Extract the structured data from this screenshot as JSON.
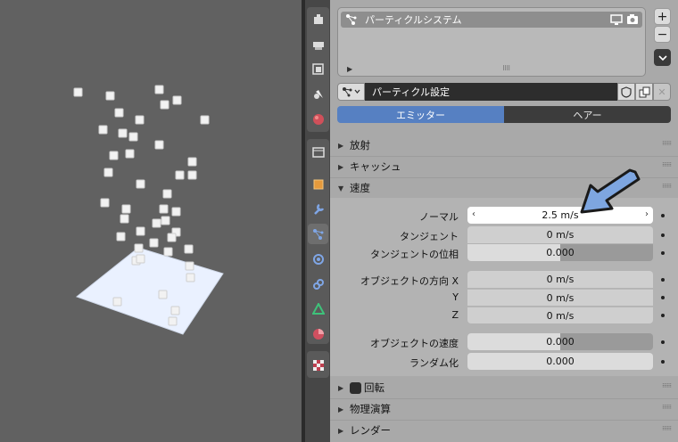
{
  "particle_system": {
    "list_item": "パーティクルシステム",
    "add_button": "+",
    "remove_button": "−"
  },
  "settings": {
    "name": "パーティクル設定"
  },
  "type_tabs": [
    {
      "label": "エミッター",
      "active": true
    },
    {
      "label": "ヘアー",
      "active": false
    }
  ],
  "panels": {
    "emission": "放射",
    "cache": "キャッシュ",
    "velocity": "速度",
    "rotation": "回転",
    "physics": "物理演算",
    "render": "レンダー"
  },
  "velocity": {
    "normal_label": "ノーマル",
    "normal_value": "2.5 m/s",
    "tangent_label": "タンジェント",
    "tangent_value": "0 m/s",
    "tangent_phase_label": "タンジェントの位相",
    "tangent_phase_value": "0.000",
    "tangent_phase_fraction": 0.5,
    "object_align_x_label": "オブジェクトの方向 X",
    "object_align_x_value": "0 m/s",
    "object_align_y_label": "Y",
    "object_align_y_value": "0 m/s",
    "object_align_z_label": "Z",
    "object_align_z_value": "0 m/s",
    "object_velocity_label": "オブジェクトの速度",
    "object_velocity_value": "0.000",
    "object_velocity_fraction": 0.5,
    "randomize_label": "ランダム化",
    "randomize_value": "0.000"
  },
  "colors": {
    "accent": "#5680c2",
    "arrow": "#7ea6e0",
    "plane": "#e8f0ff"
  }
}
